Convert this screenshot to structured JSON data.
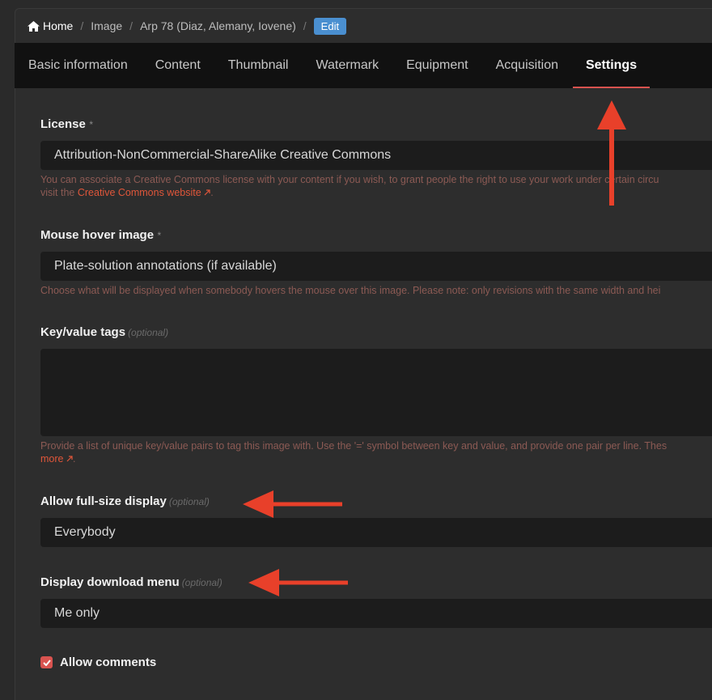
{
  "breadcrumb": {
    "home": "Home",
    "image": "Image",
    "title": "Arp 78 (Diaz, Alemany, Iovene)",
    "edit": "Edit",
    "separator": "/"
  },
  "tabs": [
    {
      "label": "Basic information"
    },
    {
      "label": "Content"
    },
    {
      "label": "Thumbnail"
    },
    {
      "label": "Watermark"
    },
    {
      "label": "Equipment"
    },
    {
      "label": "Acquisition"
    },
    {
      "label": "Settings",
      "active": true
    }
  ],
  "form": {
    "license": {
      "label": "License",
      "required_mark": "*",
      "value": "Attribution-NonCommercial-ShareAlike Creative Commons",
      "help_line1": "You can associate a Creative Commons license with your content if you wish, to grant people the right to use your work under certain circu",
      "help_line2_prefix": "visit the ",
      "help_link": "Creative Commons website",
      "help_line2_suffix": "."
    },
    "mouse_hover": {
      "label": "Mouse hover image",
      "required_mark": "*",
      "value": "Plate-solution annotations (if available)",
      "help": "Choose what will be displayed when somebody hovers the mouse over this image. Please note: only revisions with the same width and hei"
    },
    "tags": {
      "label": "Key/value tags",
      "optional": "(optional)",
      "value": "",
      "help_line1": "Provide a list of unique key/value pairs to tag this image with. Use the '=' symbol between key and value, and provide one pair per line. Thes",
      "help_link": "more",
      "help_suffix": "."
    },
    "full_size": {
      "label": "Allow full-size display",
      "optional": "(optional)",
      "value": "Everybody"
    },
    "download_menu": {
      "label": "Display download menu",
      "optional": "(optional)",
      "value": "Me only"
    },
    "comments": {
      "label": "Allow comments",
      "checked": true
    }
  },
  "colors": {
    "accent": "#d9534f",
    "arrow": "#e8402a",
    "edit_badge": "#4a8fd0"
  },
  "icons": {
    "home": "home-icon",
    "external": "external-link-icon",
    "check": "check-icon"
  }
}
